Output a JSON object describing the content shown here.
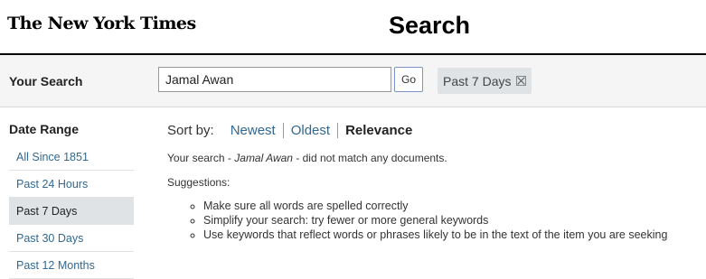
{
  "header": {
    "logo": "The New York Times",
    "title": "Search"
  },
  "search": {
    "label": "Your Search",
    "query": "Jamal Awan",
    "go_label": "Go",
    "active_filter": "Past 7 Days"
  },
  "sidebar": {
    "heading": "Date Range",
    "items": [
      {
        "label": "All Since 1851",
        "selected": false
      },
      {
        "label": "Past 24 Hours",
        "selected": false
      },
      {
        "label": "Past 7 Days",
        "selected": true
      },
      {
        "label": "Past 30 Days",
        "selected": false
      },
      {
        "label": "Past 12 Months",
        "selected": false
      }
    ]
  },
  "sort": {
    "label": "Sort by:",
    "options": [
      "Newest",
      "Oldest",
      "Relevance"
    ],
    "active": "Relevance"
  },
  "results": {
    "message_prefix": "Your search - ",
    "message_query": "Jamal Awan",
    "message_suffix": " - did not match any documents.",
    "suggestions_label": "Suggestions:",
    "suggestions": [
      "Make sure all words are spelled correctly",
      "Simplify your search: try fewer or more general keywords",
      "Use keywords that reflect words or phrases likely to be in the text of the item you are seeking"
    ]
  },
  "colors": {
    "link": "#326891",
    "chip_bg": "#dfe3e6",
    "header_rule": "#000000"
  }
}
